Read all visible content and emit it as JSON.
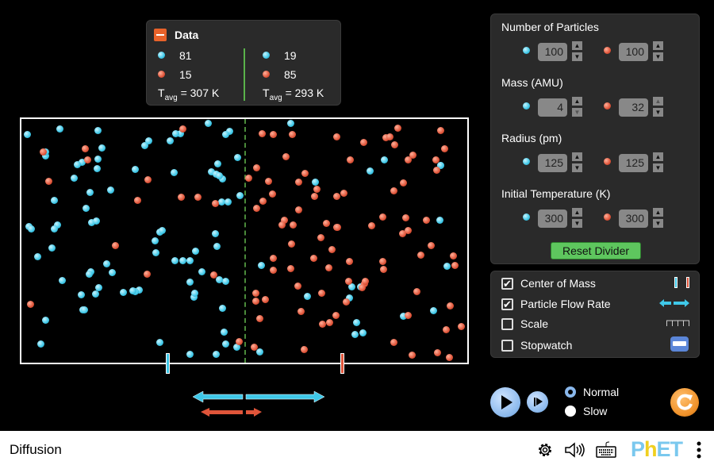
{
  "data_panel": {
    "title": "Data",
    "left": {
      "blue_count": "81",
      "red_count": "15",
      "t_label": "T",
      "t_sub": "avg",
      "t_value": " = 307 K"
    },
    "right": {
      "blue_count": "19",
      "red_count": "85",
      "t_label": "T",
      "t_sub": "avg",
      "t_value": " = 293 K"
    }
  },
  "container": {
    "left": {
      "blue": 81,
      "red": 15
    },
    "right": {
      "blue": 19,
      "red": 85
    }
  },
  "center_of_mass": {
    "blue_fraction": 0.33,
    "red_fraction": 0.72
  },
  "controls": {
    "number_label": "Number of Particles",
    "number_blue": "100",
    "number_red": "100",
    "mass_label": "Mass (AMU)",
    "mass_blue": "4",
    "mass_red": "32",
    "radius_label": "Radius (pm)",
    "radius_blue": "125",
    "radius_red": "125",
    "temp_label": "Initial Temperature (K)",
    "temp_blue": "300",
    "temp_red": "300",
    "reset_divider": "Reset Divider"
  },
  "options": [
    {
      "label": "Center of Mass",
      "checked": true
    },
    {
      "label": "Particle Flow Rate",
      "checked": true
    },
    {
      "label": "Scale",
      "checked": false
    },
    {
      "label": "Stopwatch",
      "checked": false
    }
  ],
  "speed": {
    "normal": "Normal",
    "slow": "Slow",
    "selected": "Normal"
  },
  "nav": {
    "title": "Diffusion",
    "logo": "PhET"
  },
  "colors": {
    "blue": "#3fc8e8",
    "red": "#e0553a",
    "accent_green": "#5ec65e",
    "reset_orange": "#f0922a"
  }
}
